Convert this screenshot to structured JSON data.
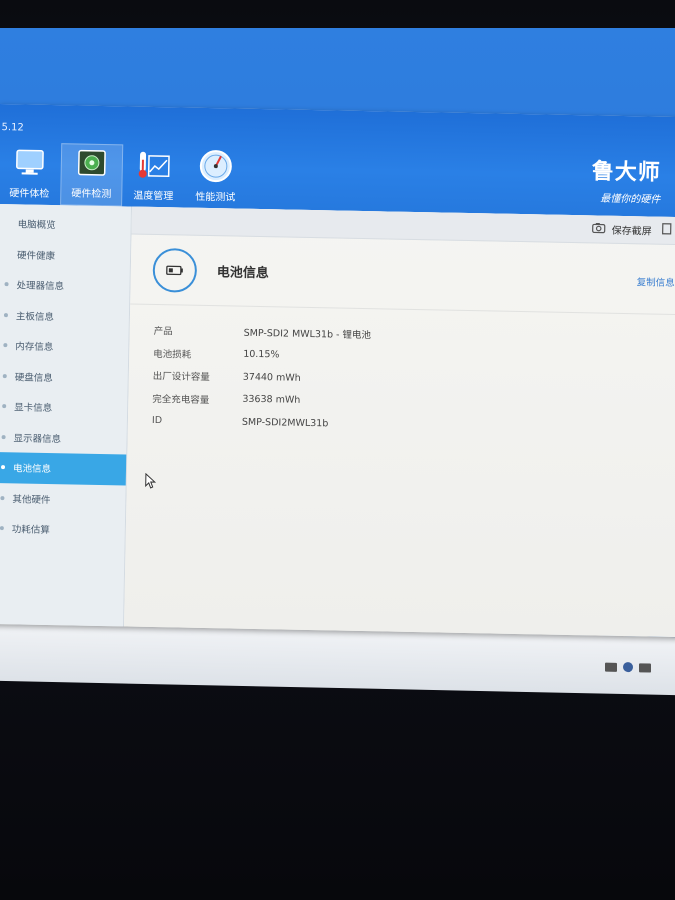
{
  "app": {
    "version": "5.12",
    "brand_name": "鲁大师",
    "brand_slogan": "最懂你的硬件"
  },
  "toolbar": {
    "items": [
      {
        "label": "硬件体检",
        "icon": "monitor-icon"
      },
      {
        "label": "硬件检测",
        "icon": "chip-icon",
        "active": true
      },
      {
        "label": "温度管理",
        "icon": "thermometer-chart-icon"
      },
      {
        "label": "性能测试",
        "icon": "gauge-icon"
      }
    ]
  },
  "sidebar": {
    "items": [
      {
        "label": "电脑概览"
      },
      {
        "label": "硬件健康"
      },
      {
        "label": "处理器信息"
      },
      {
        "label": "主板信息"
      },
      {
        "label": "内存信息"
      },
      {
        "label": "硬盘信息"
      },
      {
        "label": "显卡信息"
      },
      {
        "label": "显示器信息"
      },
      {
        "label": "电池信息",
        "active": true
      },
      {
        "label": "其他硬件"
      },
      {
        "label": "功耗估算"
      }
    ]
  },
  "actions": {
    "screenshot_label": "保存截屏"
  },
  "section": {
    "title": "电池信息",
    "copy_label": "复制信息"
  },
  "battery": {
    "rows": [
      {
        "key": "产品",
        "value": "SMP-SDI2 MWL31b -    锂电池"
      },
      {
        "key": "电池损耗",
        "value": "10.15%"
      },
      {
        "key": "出厂设计容量",
        "value": "37440 mWh"
      },
      {
        "key": "完全充电容量",
        "value": "33638 mWh"
      },
      {
        "key": "ID",
        "value": "SMP-SDI2MWL31b"
      }
    ]
  },
  "colors": {
    "accent": "#39a7e6",
    "titlebar": "#2a80e6",
    "desktop": "#2f7fe0"
  }
}
